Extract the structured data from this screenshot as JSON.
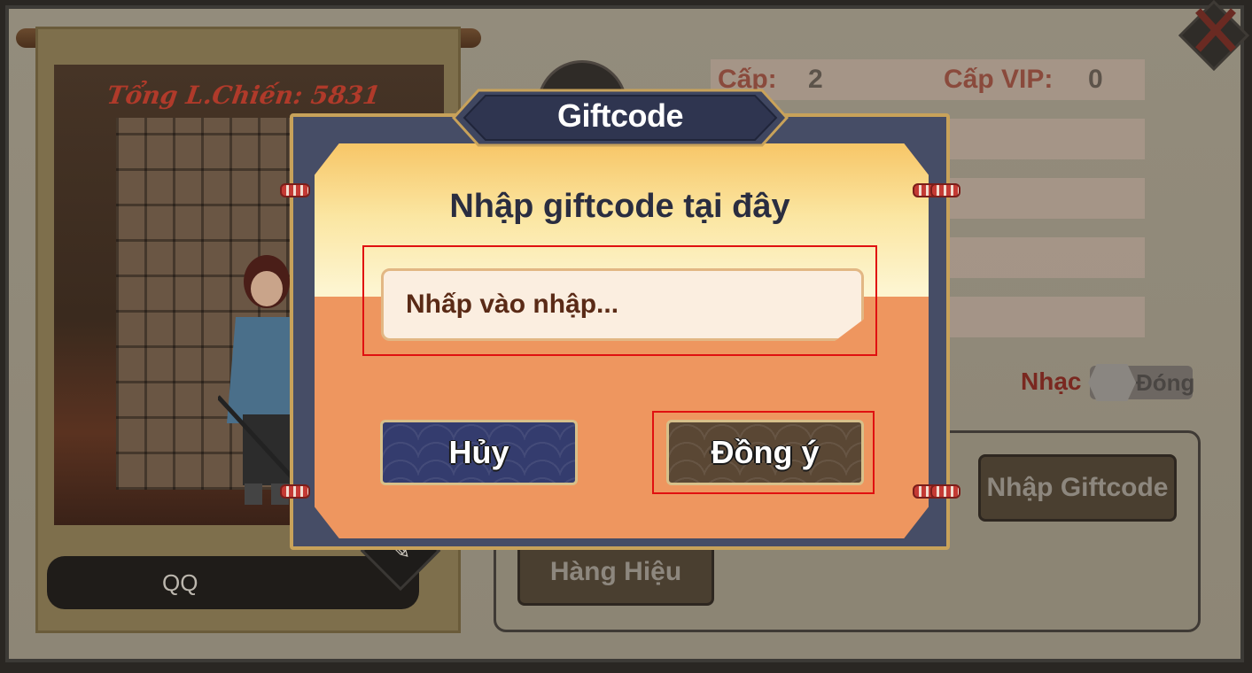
{
  "background": {
    "character_panel": {
      "combat_power_label": "Tổng L.Chiến: 5831",
      "player_name": "QQ"
    },
    "stats": {
      "level_label": "Cấp:",
      "level_value": "2",
      "vip_label": "Cấp VIP:",
      "vip_value": "0"
    },
    "settings": {
      "music_label": "Nhạc",
      "music_toggle_state": "Đóng"
    },
    "buttons": {
      "giftcode": "Nhập Giftcode",
      "brand": "Hàng Hiệu"
    }
  },
  "dialog": {
    "title": "Giftcode",
    "prompt": "Nhập giftcode tại đây",
    "input": {
      "value": "",
      "placeholder": "Nhấp vào nhập..."
    },
    "cancel_label": "Hủy",
    "confirm_label": "Đồng ý"
  },
  "colors": {
    "highlight": "#e01010",
    "dialog_body": "#ee965f",
    "dialog_frame": "#464d66",
    "accent_gold": "#c8a25a"
  }
}
